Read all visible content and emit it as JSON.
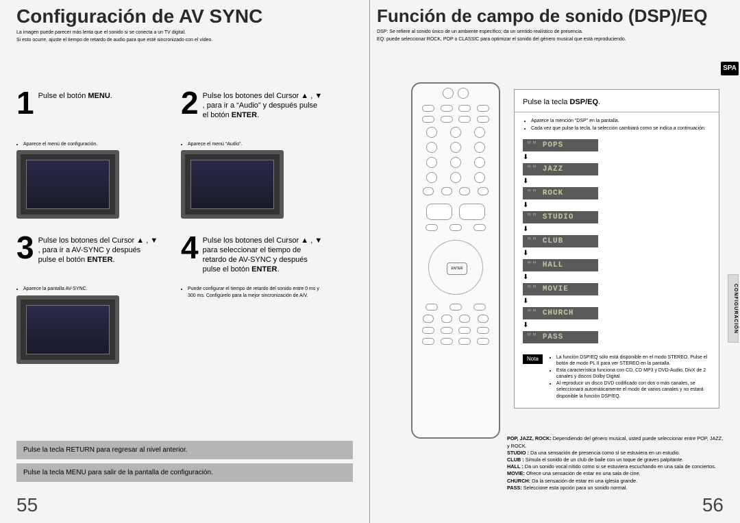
{
  "left": {
    "title": "Configuración de AV SYNC",
    "sub1": "La imagen puede parecer más lenta que el sonido si se conecta a un TV digital.",
    "sub2": "Si esto ocurre, ajuste el tiempo de retardo de audio para que esté sincronizado con el vídeo.",
    "steps": [
      {
        "num": "1",
        "text_pre": "Pulse el botón ",
        "bold1": "MENU",
        "text_post": ".",
        "bullet": "Aparece el menú de configuración."
      },
      {
        "num": "2",
        "text": "Pulse los botones del Cursor ▲ , ▼ , para ir a “Audio” y después pulse el botón ",
        "bold1": "ENTER",
        "text_post": ".",
        "bullet": "Aparece el menú “Audio”."
      },
      {
        "num": "3",
        "text": "Pulse los botones del Cursor ▲ , ▼ , para ir a AV-SYNC y después pulse el botón ",
        "bold1": "ENTER",
        "text_post": ".",
        "bullet": "Aparece la pantalla AV-SYNC."
      },
      {
        "num": "4",
        "text": "Pulse los botones del Cursor ▲ , ▼ para seleccionar el tiempo de retardo de AV-SYNC y después pulse el botón ",
        "bold1": "ENTER",
        "text_post": ".",
        "bullet": "Puede configurar el tiempo de retardo del sonido entre 0 ms y 300 ms. Configúrelo para la mejor sincronización de A/V."
      }
    ],
    "return_bar": "Pulse la tecla RETURN para regresar al nivel anterior.",
    "menu_bar": "Pulse la tecla MENU para salir de la pantalla de configuración.",
    "page_num": "55"
  },
  "right": {
    "title": "Función de campo de sonido (DSP)/EQ",
    "sub1": "DSP: Se refiere al sonido único de un ambiente específico; da un sentido realístico de presencia.",
    "sub2": "EQ: puede seleccionar ROCK, POP o CLASSIC para optimizar el sonido del género musical que está reproduciendo.",
    "sp_badge": "SPA",
    "side_label": "CONFIGURACIÓN",
    "dsp_instr_pre": "Pulse la tecla ",
    "dsp_instr_bold": "DSP/EQ",
    "dsp_instr_post": ".",
    "dsp_bullets": [
      "Aparece la mención \"DSP\" en la pantalla.",
      "Cada vez que pulse la tecla, la selección cambiará como se indica a continuación:"
    ],
    "modes": [
      "POPS",
      "JAZZ",
      "ROCK",
      "STUDIO",
      "CLUB",
      "HALL",
      "MOVIE",
      "CHURCH",
      "PASS"
    ],
    "nota_label": "Nota",
    "nota_items": [
      "La función DSP/EQ sólo está disponible en el modo STEREO. Pulse el botón de modo    PL II para ver STEREO en la pantalla.",
      "Esta característica funciona con CD, CD MP3 y DVD-Audio, DivX de 2 canales y discos Dolby Digital.",
      "Al reproducir un disco DVD codificado con dos o más canales, se seleccionará automáticamente el modo de varios canales y no estará disponible la función DSP/EQ."
    ],
    "glossary": [
      {
        "k": "POP, JAZZ, ROCK:",
        "v": " Dependiendo del género musical, usted puede seleccionar entre POP, JAZZ, y ROCK."
      },
      {
        "k": "STUDIO :",
        "v": " Da una sensación de presencia como si se estuviera en un estudio."
      },
      {
        "k": "CLUB :",
        "v": " Simula el sonido de un club de baile con un toque de graves palpitante."
      },
      {
        "k": "HALL :",
        "v": " Da un sonido vocal nítido como si se estuviera escuchando en una sala de conciertos."
      },
      {
        "k": "MOVIE:",
        "v": " Ofrece una sensación de estar en una sala de cine."
      },
      {
        "k": "CHURCH:",
        "v": " Da la sensación de estar en una iglesia grande."
      },
      {
        "k": "PASS:",
        "v": " Seleccione esta opción para un sonido normal."
      }
    ],
    "page_num": "56"
  }
}
